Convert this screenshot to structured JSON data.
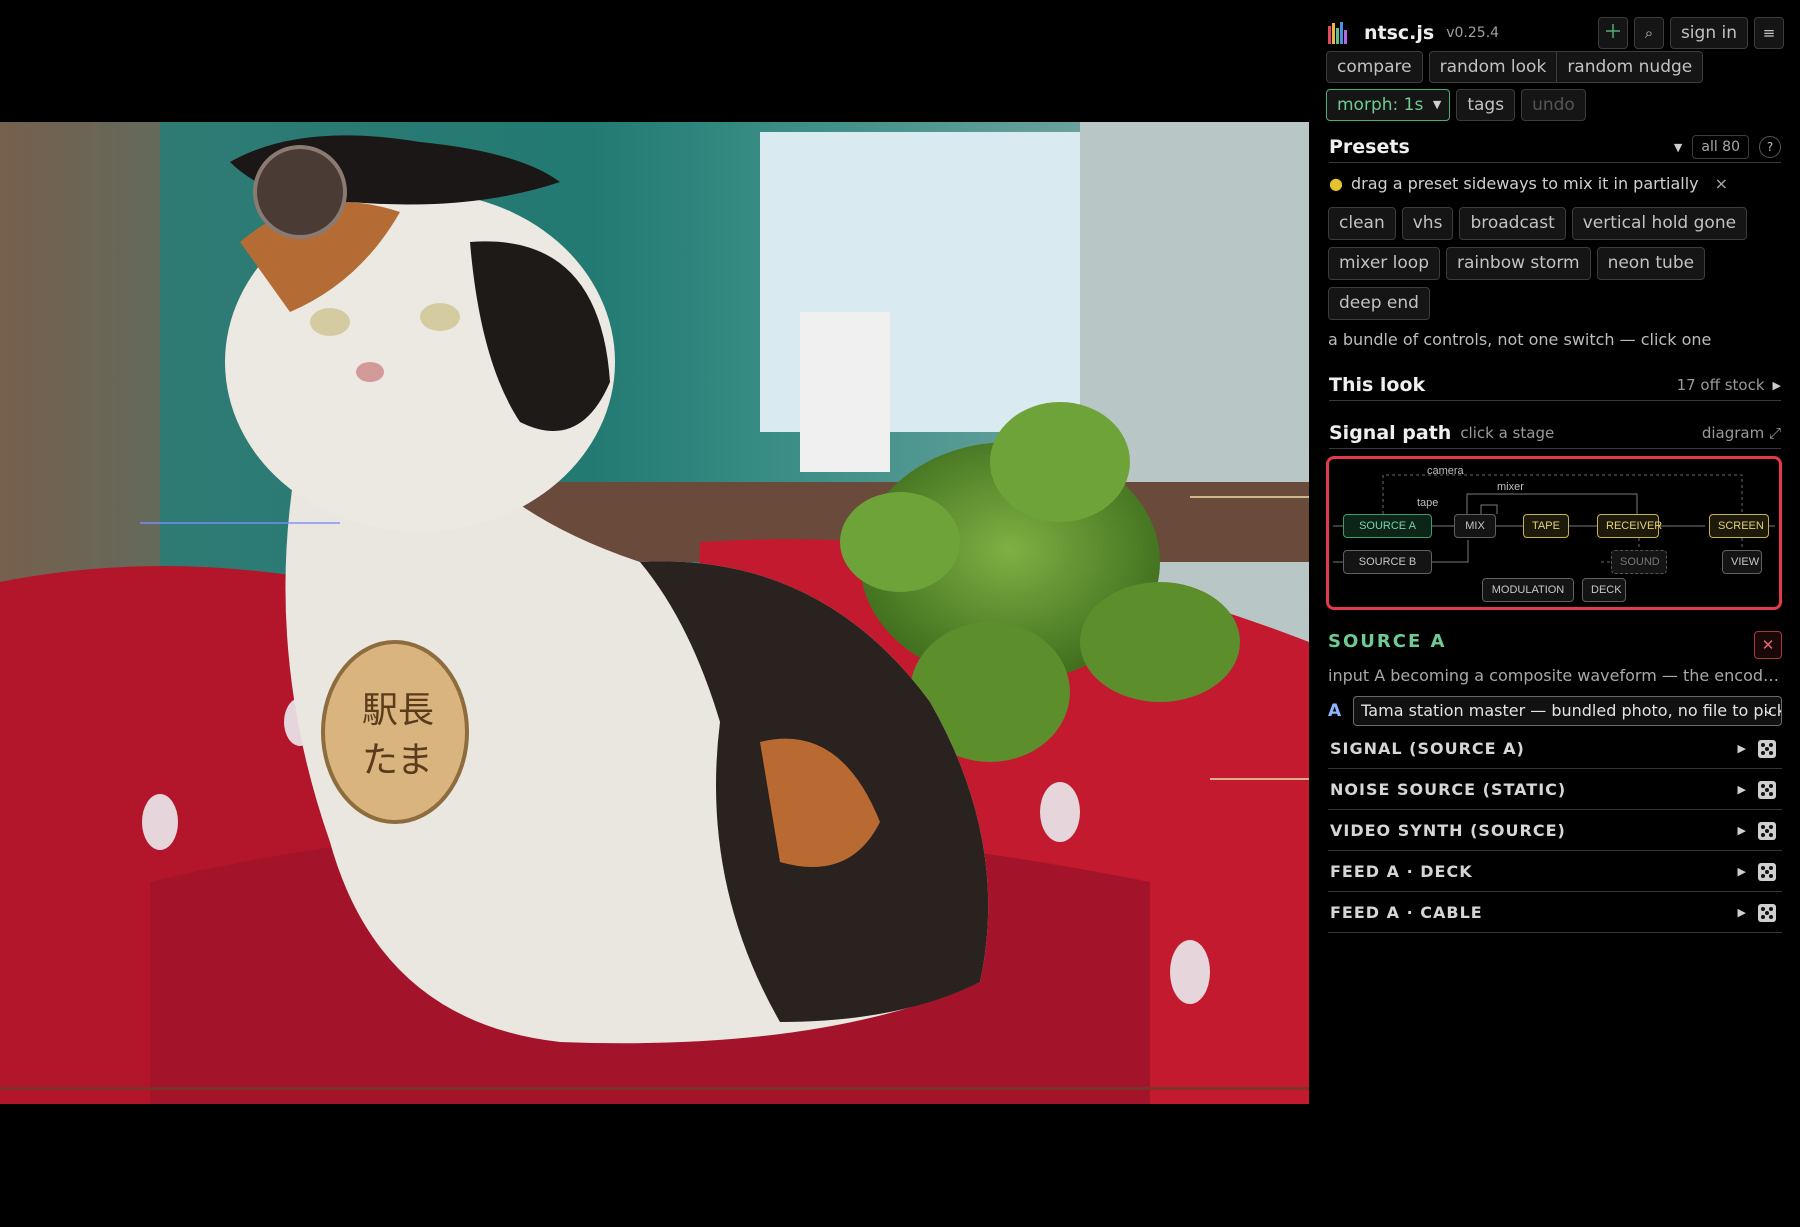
{
  "app": {
    "name": "ntsc.js",
    "version": "v0.25.4"
  },
  "toolbar": {
    "crosshair_icon": "crosshair-icon",
    "search_icon": "search-icon",
    "sign_in": "sign in",
    "menu_icon": "hamburger-menu-icon",
    "compare": "compare",
    "random_look": "random look",
    "random_nudge": "random nudge",
    "morph": "morph: 1s",
    "tags": "tags",
    "undo": "undo"
  },
  "presets": {
    "title": "Presets",
    "filter": "all 80",
    "help": "?",
    "hint": "drag a preset sideways to mix it in partially",
    "hint_close": "×",
    "items": [
      "clean",
      "vhs",
      "broadcast",
      "vertical hold gone",
      "mixer loop",
      "rainbow storm",
      "neon tube",
      "deep end"
    ],
    "note": "a bundle of controls, not one switch — click one"
  },
  "this_look": {
    "title": "This look",
    "status": "17 off stock"
  },
  "signal_path": {
    "title": "Signal path",
    "sub": "click a stage",
    "diagram_link": "diagram ⤢",
    "labels": {
      "camera": "camera",
      "mixer": "mixer",
      "tape": "tape"
    },
    "nodes": {
      "source_a": "SOURCE A",
      "source_b": "SOURCE B",
      "mix": "MIX",
      "tape": "TAPE",
      "receiver": "RECEIVER",
      "screen": "SCREEN",
      "sound": "SOUND",
      "view": "VIEW",
      "modulation": "MODULATION",
      "deck": "DECK"
    },
    "colors": {
      "highlight": "#e23a4a",
      "active": "#6fcb93",
      "stage": "#e3d17a"
    }
  },
  "stage": {
    "title": "SOURCE A",
    "description": "input A becoming a composite waveform — the encoder stage",
    "input_letter": "A",
    "input_value": "Tama station master — bundled photo, no file to pick"
  },
  "sections": [
    "SIGNAL (SOURCE A)",
    "NOISE SOURCE (STATIC)",
    "VIDEO SYNTH (SOURCE)",
    "FEED A · DECK",
    "FEED A · CABLE"
  ]
}
